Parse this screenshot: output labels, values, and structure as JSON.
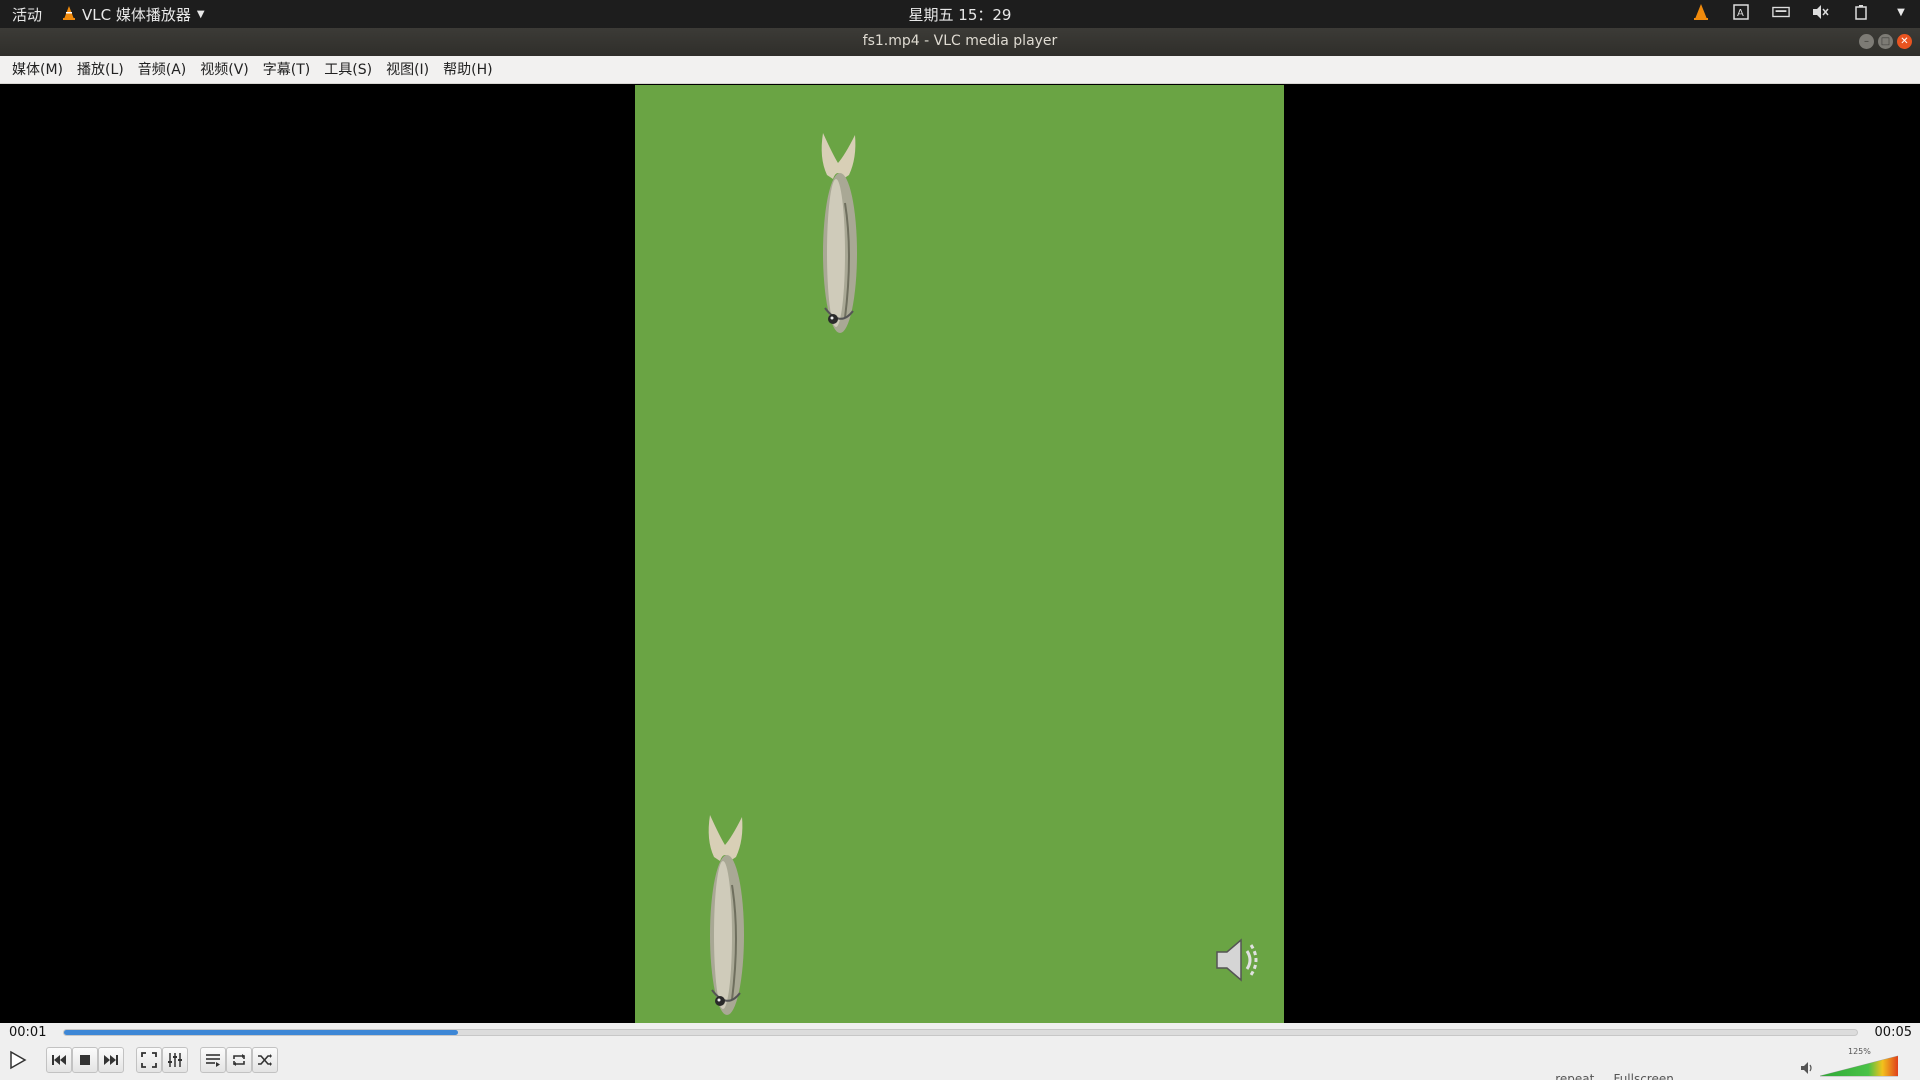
{
  "topbar": {
    "activities": "活动",
    "app_name": "VLC 媒体播放器",
    "clock": "星期五 15：29",
    "tray_icons": [
      "vlc-tray-icon",
      "input-method-icon",
      "keyboard-icon",
      "volume-muted-icon",
      "battery-icon",
      "menu-arrow-icon"
    ]
  },
  "window": {
    "title": "fs1.mp4 - VLC media player",
    "controls": [
      "minimize",
      "maximize",
      "close"
    ]
  },
  "menu": [
    {
      "label": "媒体(M)"
    },
    {
      "label": "播放(L)"
    },
    {
      "label": "音频(A)"
    },
    {
      "label": "视频(V)"
    },
    {
      "label": "字幕(T)"
    },
    {
      "label": "工具(S)"
    },
    {
      "label": "视图(I)"
    },
    {
      "label": "帮助(H)"
    }
  ],
  "player": {
    "elapsed": "00:01",
    "total": "00:05",
    "progress": 0.22,
    "volume_label": "125%",
    "volume_level": 1.0,
    "osd_icon": "speaker-icon",
    "status_partial": "... repeat ... Fullscreen ..."
  },
  "colors": {
    "accent": "#3d87d6",
    "video_bg": "#6aa444",
    "close_button": "#e95420"
  }
}
